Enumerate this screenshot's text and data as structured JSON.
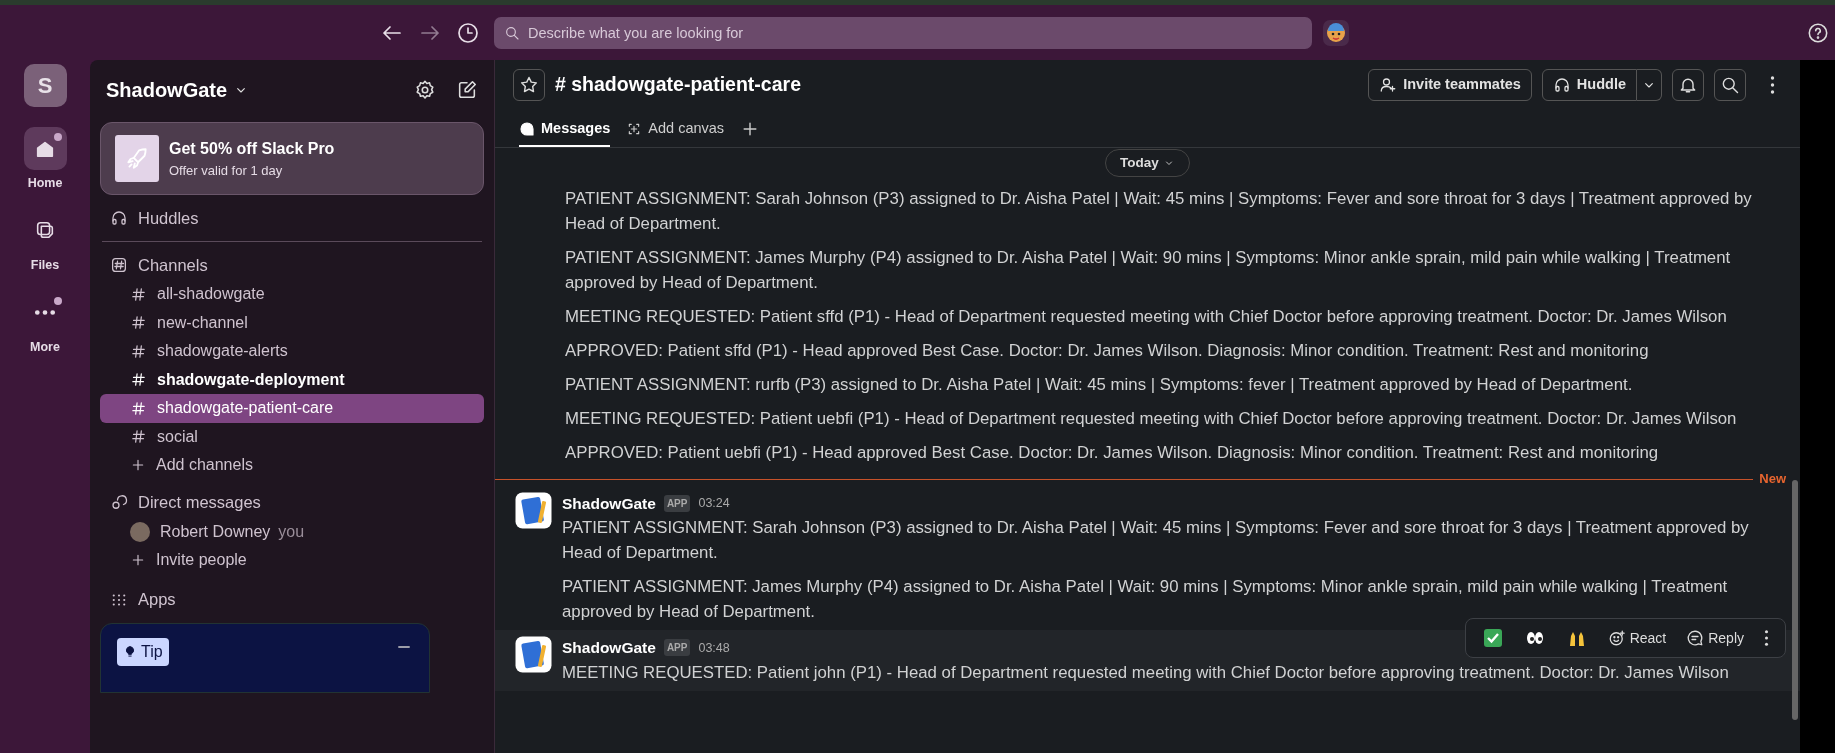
{
  "top_bar": {
    "search": {
      "placeholder": "Describe what you are looking for"
    }
  },
  "rail": {
    "workspace_initial": "S",
    "items": [
      {
        "kind": "home",
        "label": "Home",
        "selected": true,
        "unread": true
      },
      {
        "kind": "files",
        "label": "Files",
        "selected": false,
        "unread": false
      },
      {
        "kind": "more",
        "label": "More",
        "selected": false,
        "unread": true
      }
    ]
  },
  "sidebar": {
    "workspace": "ShadowGate",
    "promo": {
      "title": "Get 50% off Slack Pro",
      "subtitle": "Offer valid for 1 day"
    },
    "huddles": "Huddles",
    "channels": {
      "heading": "Channels",
      "items": [
        {
          "name": "all-shadowgate",
          "unread": false,
          "selected": false
        },
        {
          "name": "new-channel",
          "unread": false,
          "selected": false
        },
        {
          "name": "shadowgate-alerts",
          "unread": false,
          "selected": false
        },
        {
          "name": "shadowgate-deployment",
          "unread": true,
          "selected": false
        },
        {
          "name": "shadowgate-patient-care",
          "unread": false,
          "selected": true
        },
        {
          "name": "social",
          "unread": false,
          "selected": false
        }
      ],
      "add": "Add channels"
    },
    "direct_messages": {
      "heading": "Direct messages",
      "items": [
        {
          "name": "Robert Downey",
          "note": "you"
        }
      ],
      "invite": "Invite people"
    },
    "apps": "Apps",
    "tip": {
      "badge": "Tip"
    }
  },
  "channel": {
    "title": "# shadowgate-patient-care",
    "invite": "Invite teammates",
    "huddle": "Huddle",
    "tabs": [
      {
        "kind": "messages",
        "label": "Messages",
        "selected": true
      },
      {
        "kind": "canvas",
        "label": "Add canvas",
        "selected": false
      }
    ]
  },
  "messages": {
    "today": "Today",
    "new_label": "New",
    "react": "React",
    "reply": "Reply",
    "groups": [
      {
        "messages": [
          "PATIENT ASSIGNMENT: Sarah Johnson (P3) assigned to Dr. Aisha Patel | Wait: 45 mins | Symptoms: Fever and sore throat for 3 days | Treatment approved by Head of Department.",
          "PATIENT ASSIGNMENT: James Murphy (P4) assigned to Dr. Aisha Patel | Wait: 90 mins | Symptoms: Minor ankle sprain, mild pain while walking | Treatment approved by Head of Department.",
          "MEETING REQUESTED: Patient sffd (P1) - Head of Department requested meeting with Chief Doctor before approving treatment. Doctor: Dr. James Wilson",
          "APPROVED: Patient sffd (P1) - Head approved Best Case. Doctor: Dr. James Wilson. Diagnosis: Minor condition. Treatment: Rest and monitoring",
          "PATIENT ASSIGNMENT: rurfb (P3) assigned to Dr. Aisha Patel | Wait: 45 mins | Symptoms: fever | Treatment approved by Head of Department.",
          "MEETING REQUESTED: Patient uebfi (P1) - Head of Department requested meeting with Chief Doctor before approving treatment. Doctor: Dr. James Wilson",
          "APPROVED: Patient uebfi (P1) - Head approved Best Case. Doctor: Dr. James Wilson. Diagnosis: Minor condition. Treatment: Rest and monitoring"
        ]
      },
      {
        "new_divider": true,
        "author": "ShadowGate",
        "badge": "APP",
        "time": "03:24",
        "messages": [
          "PATIENT ASSIGNMENT: Sarah Johnson (P3) assigned to Dr. Aisha Patel | Wait: 45 mins | Symptoms: Fever and sore throat for 3 days | Treatment approved by Head of Department.",
          "PATIENT ASSIGNMENT: James Murphy (P4) assigned to Dr. Aisha Patel | Wait: 90 mins | Symptoms: Minor ankle sprain, mild pain while walking | Treatment approved by Head of Department."
        ]
      },
      {
        "hovered": true,
        "author": "ShadowGate",
        "badge": "APP",
        "time": "03:48",
        "messages": [
          "MEETING REQUESTED: Patient john (P1) - Head of Department requested meeting with Chief Doctor before approving treatment. Doctor: Dr. James Wilson"
        ]
      }
    ]
  }
}
